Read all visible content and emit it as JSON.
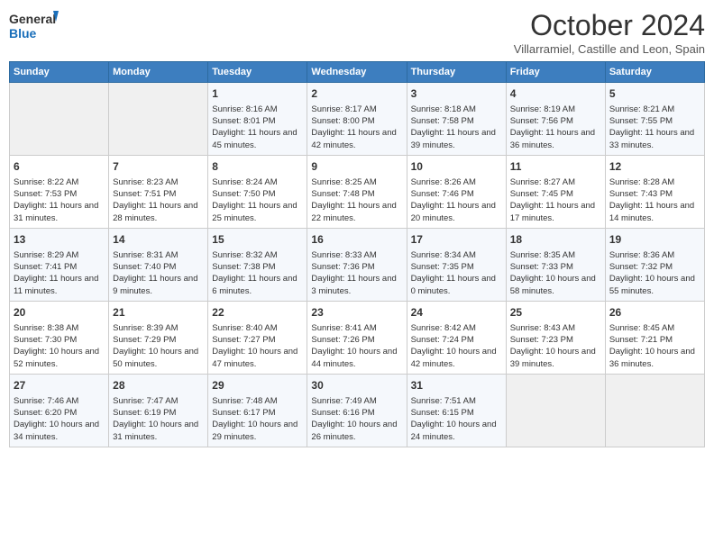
{
  "header": {
    "logo_line1": "General",
    "logo_line2": "Blue",
    "month": "October 2024",
    "location": "Villarramiel, Castille and Leon, Spain"
  },
  "weekdays": [
    "Sunday",
    "Monday",
    "Tuesday",
    "Wednesday",
    "Thursday",
    "Friday",
    "Saturday"
  ],
  "weeks": [
    [
      {
        "day": "",
        "empty": true
      },
      {
        "day": "",
        "empty": true
      },
      {
        "day": "1",
        "sunrise": "8:16 AM",
        "sunset": "8:01 PM",
        "daylight": "11 hours and 45 minutes."
      },
      {
        "day": "2",
        "sunrise": "8:17 AM",
        "sunset": "8:00 PM",
        "daylight": "11 hours and 42 minutes."
      },
      {
        "day": "3",
        "sunrise": "8:18 AM",
        "sunset": "7:58 PM",
        "daylight": "11 hours and 39 minutes."
      },
      {
        "day": "4",
        "sunrise": "8:19 AM",
        "sunset": "7:56 PM",
        "daylight": "11 hours and 36 minutes."
      },
      {
        "day": "5",
        "sunrise": "8:21 AM",
        "sunset": "7:55 PM",
        "daylight": "11 hours and 33 minutes."
      }
    ],
    [
      {
        "day": "6",
        "sunrise": "8:22 AM",
        "sunset": "7:53 PM",
        "daylight": "11 hours and 31 minutes."
      },
      {
        "day": "7",
        "sunrise": "8:23 AM",
        "sunset": "7:51 PM",
        "daylight": "11 hours and 28 minutes."
      },
      {
        "day": "8",
        "sunrise": "8:24 AM",
        "sunset": "7:50 PM",
        "daylight": "11 hours and 25 minutes."
      },
      {
        "day": "9",
        "sunrise": "8:25 AM",
        "sunset": "7:48 PM",
        "daylight": "11 hours and 22 minutes."
      },
      {
        "day": "10",
        "sunrise": "8:26 AM",
        "sunset": "7:46 PM",
        "daylight": "11 hours and 20 minutes."
      },
      {
        "day": "11",
        "sunrise": "8:27 AM",
        "sunset": "7:45 PM",
        "daylight": "11 hours and 17 minutes."
      },
      {
        "day": "12",
        "sunrise": "8:28 AM",
        "sunset": "7:43 PM",
        "daylight": "11 hours and 14 minutes."
      }
    ],
    [
      {
        "day": "13",
        "sunrise": "8:29 AM",
        "sunset": "7:41 PM",
        "daylight": "11 hours and 11 minutes."
      },
      {
        "day": "14",
        "sunrise": "8:31 AM",
        "sunset": "7:40 PM",
        "daylight": "11 hours and 9 minutes."
      },
      {
        "day": "15",
        "sunrise": "8:32 AM",
        "sunset": "7:38 PM",
        "daylight": "11 hours and 6 minutes."
      },
      {
        "day": "16",
        "sunrise": "8:33 AM",
        "sunset": "7:36 PM",
        "daylight": "11 hours and 3 minutes."
      },
      {
        "day": "17",
        "sunrise": "8:34 AM",
        "sunset": "7:35 PM",
        "daylight": "11 hours and 0 minutes."
      },
      {
        "day": "18",
        "sunrise": "8:35 AM",
        "sunset": "7:33 PM",
        "daylight": "10 hours and 58 minutes."
      },
      {
        "day": "19",
        "sunrise": "8:36 AM",
        "sunset": "7:32 PM",
        "daylight": "10 hours and 55 minutes."
      }
    ],
    [
      {
        "day": "20",
        "sunrise": "8:38 AM",
        "sunset": "7:30 PM",
        "daylight": "10 hours and 52 minutes."
      },
      {
        "day": "21",
        "sunrise": "8:39 AM",
        "sunset": "7:29 PM",
        "daylight": "10 hours and 50 minutes."
      },
      {
        "day": "22",
        "sunrise": "8:40 AM",
        "sunset": "7:27 PM",
        "daylight": "10 hours and 47 minutes."
      },
      {
        "day": "23",
        "sunrise": "8:41 AM",
        "sunset": "7:26 PM",
        "daylight": "10 hours and 44 minutes."
      },
      {
        "day": "24",
        "sunrise": "8:42 AM",
        "sunset": "7:24 PM",
        "daylight": "10 hours and 42 minutes."
      },
      {
        "day": "25",
        "sunrise": "8:43 AM",
        "sunset": "7:23 PM",
        "daylight": "10 hours and 39 minutes."
      },
      {
        "day": "26",
        "sunrise": "8:45 AM",
        "sunset": "7:21 PM",
        "daylight": "10 hours and 36 minutes."
      }
    ],
    [
      {
        "day": "27",
        "sunrise": "7:46 AM",
        "sunset": "6:20 PM",
        "daylight": "10 hours and 34 minutes."
      },
      {
        "day": "28",
        "sunrise": "7:47 AM",
        "sunset": "6:19 PM",
        "daylight": "10 hours and 31 minutes."
      },
      {
        "day": "29",
        "sunrise": "7:48 AM",
        "sunset": "6:17 PM",
        "daylight": "10 hours and 29 minutes."
      },
      {
        "day": "30",
        "sunrise": "7:49 AM",
        "sunset": "6:16 PM",
        "daylight": "10 hours and 26 minutes."
      },
      {
        "day": "31",
        "sunrise": "7:51 AM",
        "sunset": "6:15 PM",
        "daylight": "10 hours and 24 minutes."
      },
      {
        "day": "",
        "empty": true
      },
      {
        "day": "",
        "empty": true
      }
    ]
  ],
  "labels": {
    "sunrise_prefix": "Sunrise: ",
    "sunset_prefix": "Sunset: ",
    "daylight_prefix": "Daylight: "
  }
}
